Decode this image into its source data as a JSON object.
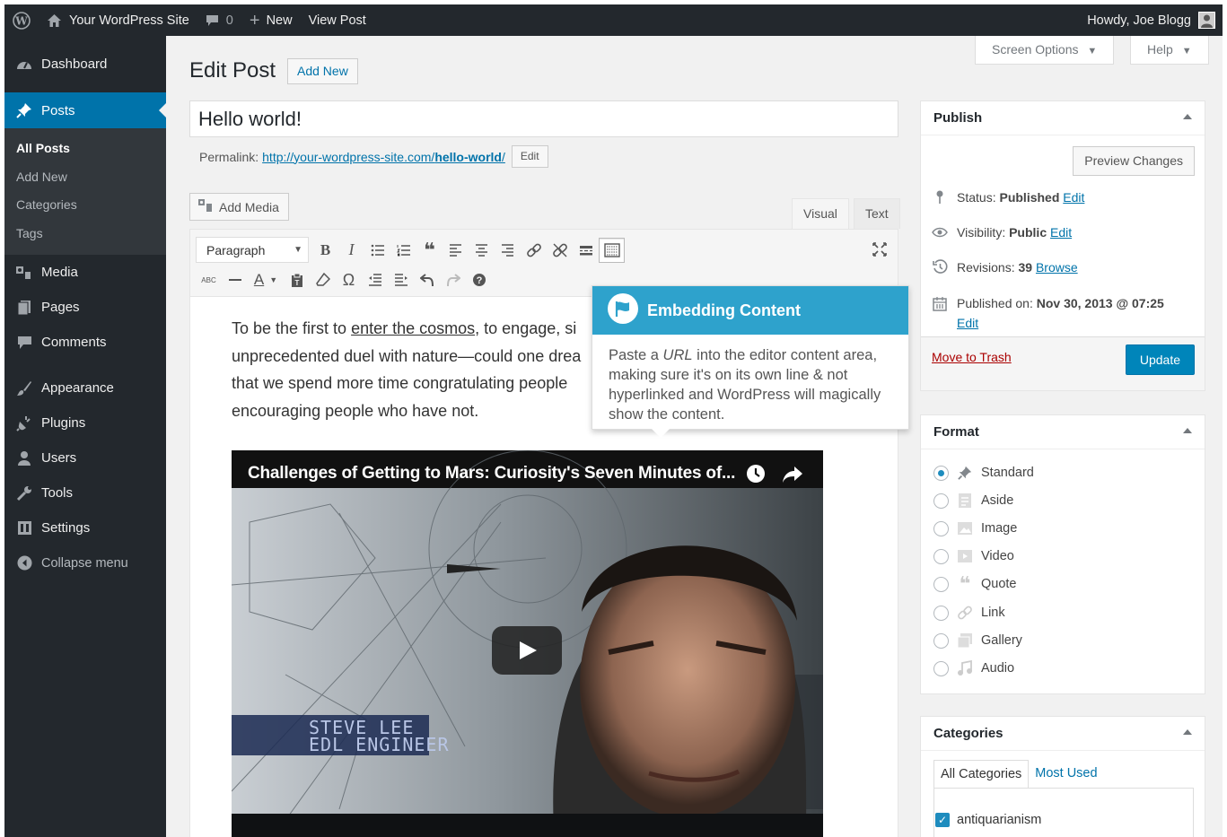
{
  "admin_bar": {
    "site_name": "Your WordPress Site",
    "comments_count": "0",
    "new_label": "New",
    "view_post_label": "View Post",
    "greeting": "Howdy, Joe Blogg"
  },
  "sidebar": {
    "dashboard": "Dashboard",
    "posts": "Posts",
    "posts_sub": [
      "All Posts",
      "Add New",
      "Categories",
      "Tags"
    ],
    "media": "Media",
    "pages": "Pages",
    "comments": "Comments",
    "appearance": "Appearance",
    "plugins": "Plugins",
    "users": "Users",
    "tools": "Tools",
    "settings": "Settings",
    "collapse": "Collapse menu"
  },
  "header": {
    "title": "Edit Post",
    "add_new": "Add New",
    "screen_options": "Screen Options",
    "help": "Help"
  },
  "post": {
    "title": "Hello world!",
    "permalink_label": "Permalink:",
    "permalink_base": "http://your-wordpress-site.com/",
    "permalink_slug": "hello-world",
    "permalink_trail": "/",
    "permalink_edit": "Edit"
  },
  "editor": {
    "add_media": "Add Media",
    "tab_visual": "Visual",
    "tab_text": "Text",
    "format": "Paragraph",
    "content_pre": "To be the first to ",
    "content_link": "enter the cosmos",
    "content_line1_post": ", to engage, si",
    "content_line2": "unprecedented duel with nature—could one drea",
    "content_line3": "that we spend more time congratulating people",
    "content_line4": "encouraging people who have not."
  },
  "video": {
    "title": "Challenges of Getting to Mars: Curiosity's Seven Minutes of...",
    "caption_name": "STEVE LEE",
    "caption_role": "EDL ENGINEER"
  },
  "pointer": {
    "title": "Embedding Content",
    "body_pre": "Paste a ",
    "body_em": "URL",
    "body_post": " into the editor content area, making sure it's on its own line & not hyperlinked and WordPress will magically show the content."
  },
  "publish": {
    "title": "Publish",
    "preview": "Preview Changes",
    "status_label": "Status:",
    "status_value": "Published",
    "visibility_label": "Visibility:",
    "visibility_value": "Public",
    "revisions_label": "Revisions:",
    "revisions_value": "39",
    "browse": "Browse",
    "published_label": "Published on:",
    "published_value": "Nov 30, 2013 @ 07:25",
    "edit": "Edit",
    "trash": "Move to Trash",
    "update": "Update"
  },
  "format_box": {
    "title": "Format",
    "options": [
      "Standard",
      "Aside",
      "Image",
      "Video",
      "Quote",
      "Link",
      "Gallery",
      "Audio"
    ],
    "selected": "Standard"
  },
  "categories_box": {
    "title": "Categories",
    "tab_all": "All Categories",
    "tab_used": "Most Used",
    "items": [
      "antiquarianism"
    ]
  },
  "colors": {
    "admin_dark": "#23282d",
    "accent_blue": "#0073aa",
    "pointer_blue": "#2ea2cc",
    "update_blue": "#0085ba"
  }
}
